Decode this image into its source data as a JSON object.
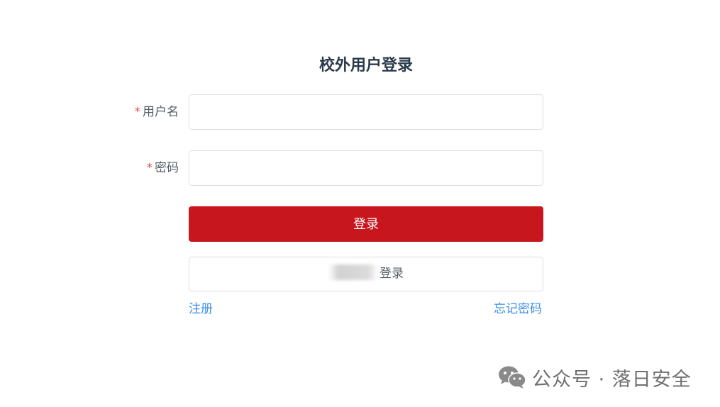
{
  "form": {
    "title": "校外用户登录",
    "username": {
      "required_mark": "*",
      "label": "用户名",
      "value": "",
      "placeholder": ""
    },
    "password": {
      "required_mark": "*",
      "label": "密码",
      "value": "",
      "placeholder": ""
    },
    "login_button": "登录",
    "alt_login_button": "登录",
    "register_link": "注册",
    "forgot_link": "忘记密码"
  },
  "watermark": {
    "text": "公众号 · 落日安全",
    "icon": "wechat-icon"
  },
  "colors": {
    "primary": "#c8161e",
    "link": "#3a8ee6",
    "required": "#e05252",
    "title": "#2b3a4a"
  }
}
